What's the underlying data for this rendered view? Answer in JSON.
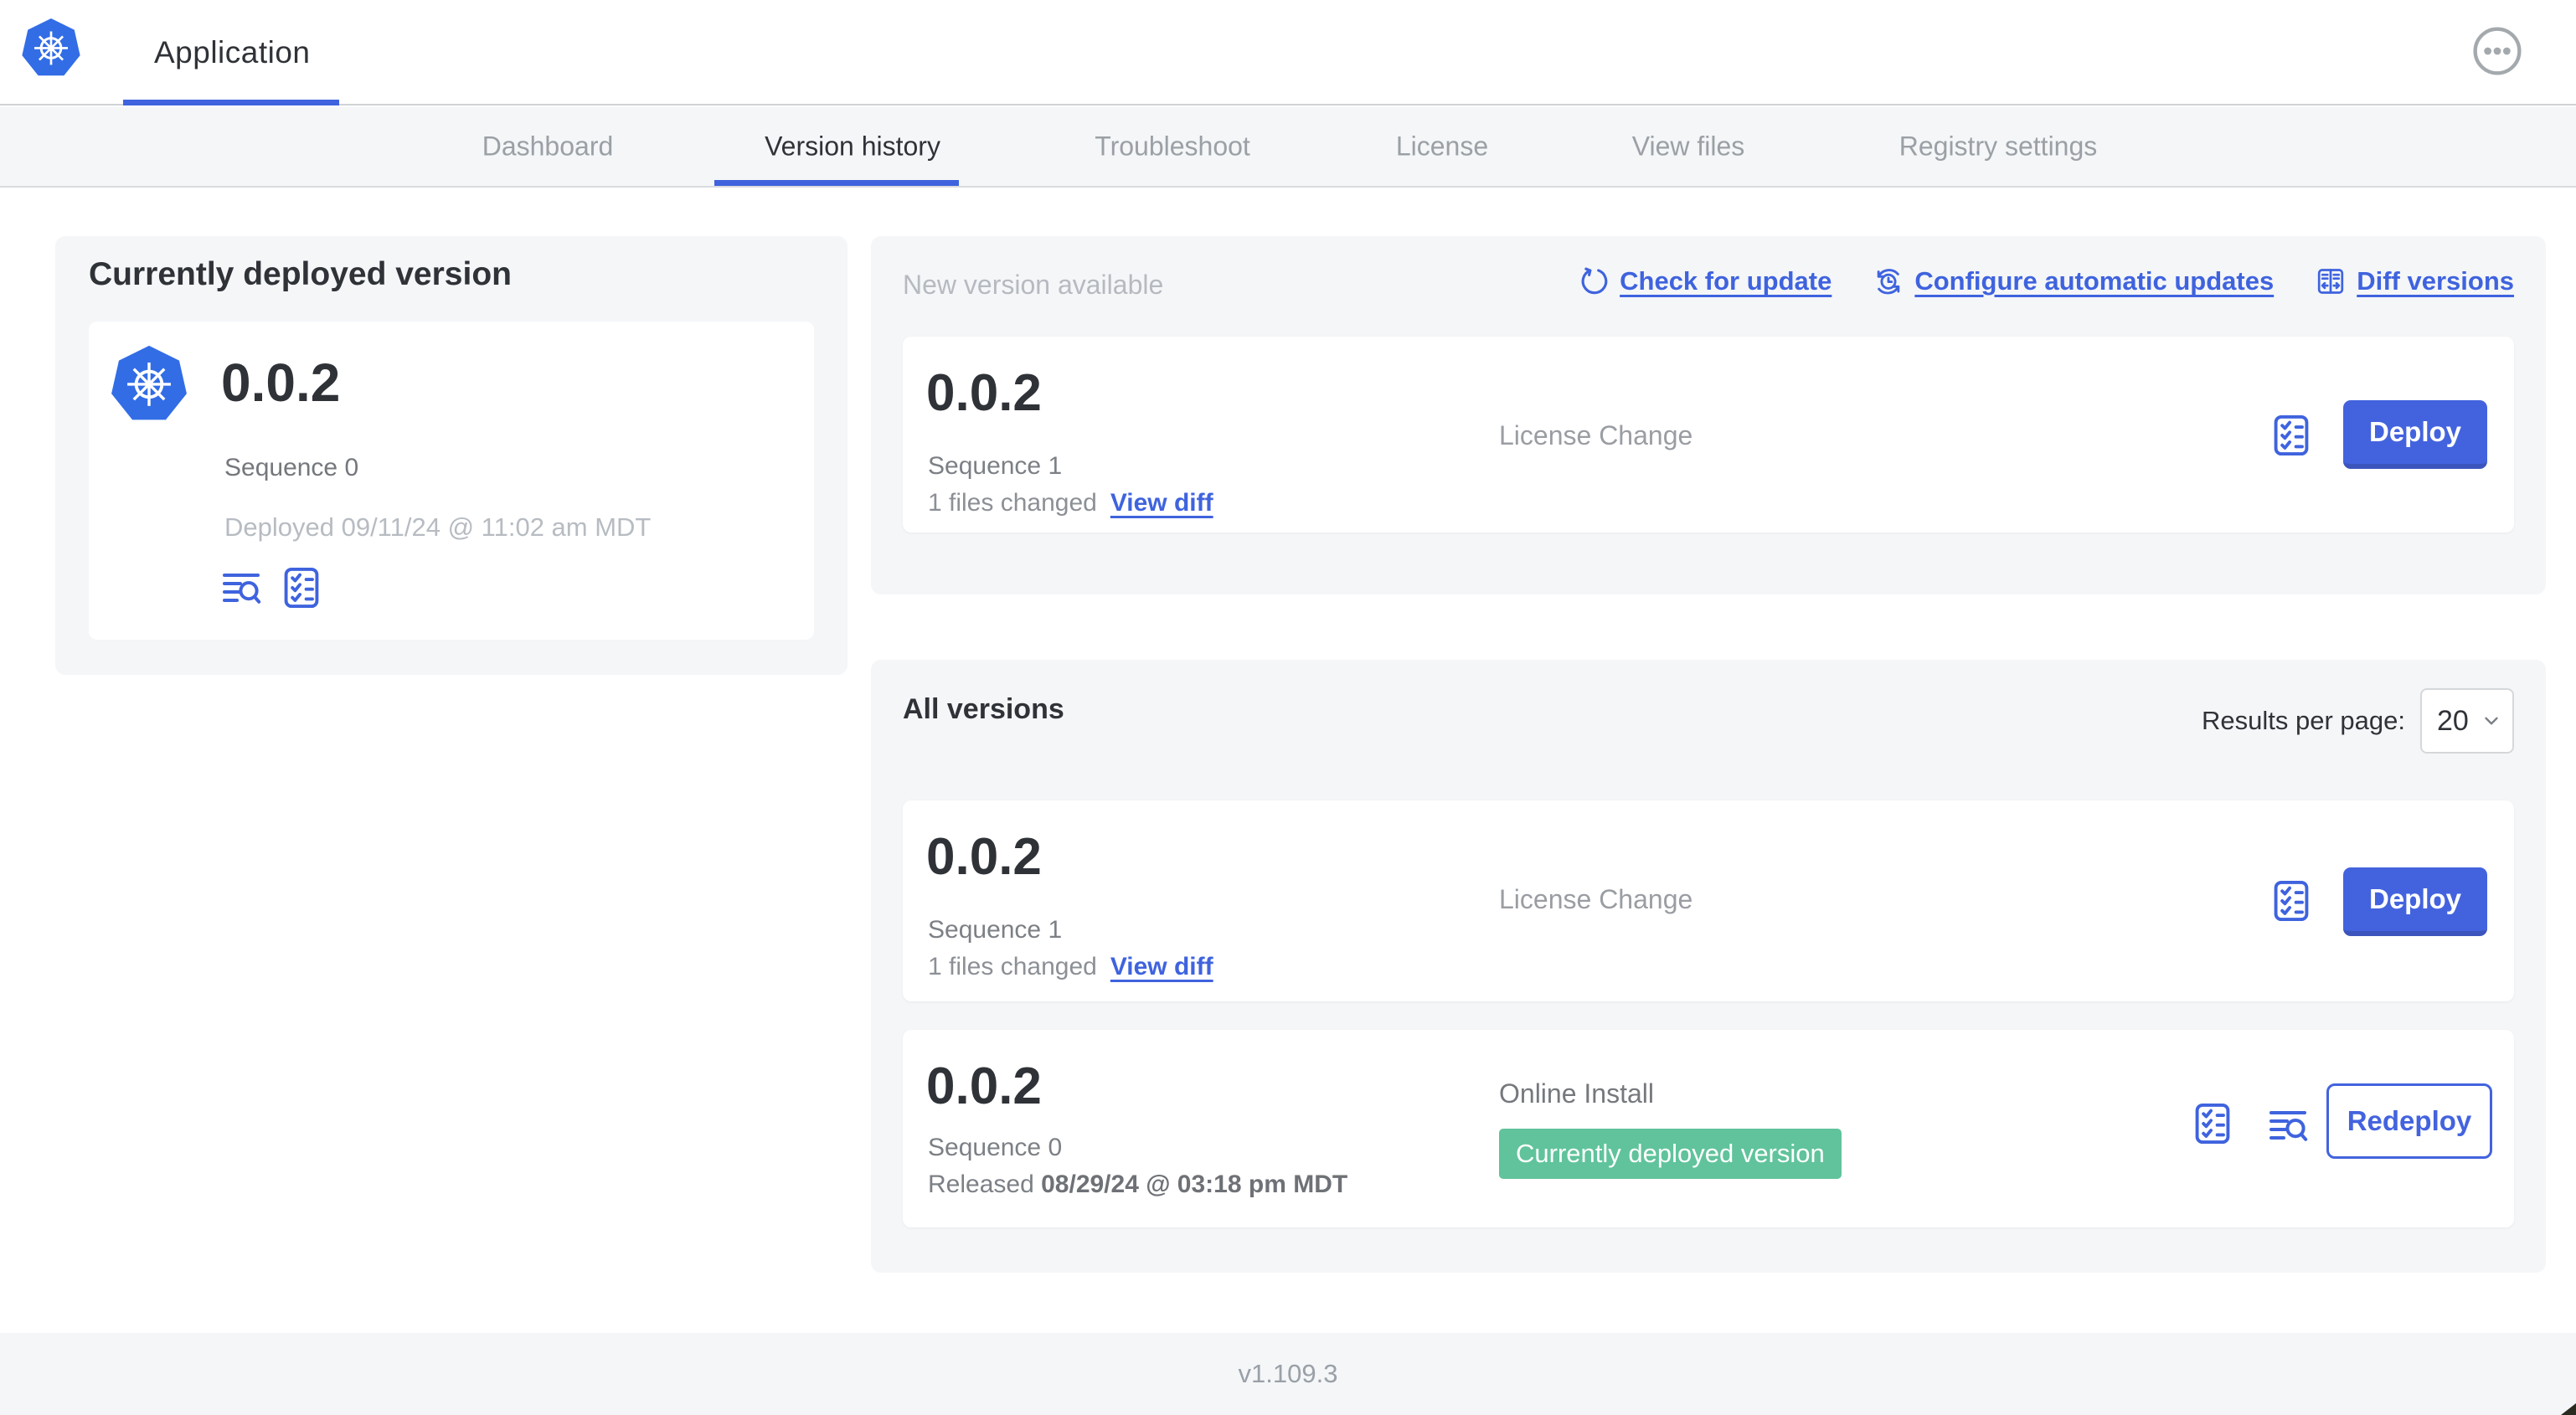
{
  "header": {
    "title": "Application"
  },
  "tabs": {
    "dashboard": "Dashboard",
    "version_history": "Version history",
    "troubleshoot": "Troubleshoot",
    "license": "License",
    "view_files": "View files",
    "registry_settings": "Registry settings"
  },
  "currently_deployed": {
    "heading": "Currently deployed version",
    "version": "0.0.2",
    "sequence": "Sequence 0",
    "deployed_at": "Deployed 09/11/24 @ 11:02 am MDT"
  },
  "new_version": {
    "heading": "New version available",
    "check_for_update": "Check for update",
    "configure_updates": "Configure automatic updates",
    "diff_versions": "Diff versions",
    "row": {
      "version": "0.0.2",
      "sequence": "Sequence 1",
      "files_changed": "1 files changed",
      "view_diff": "View diff",
      "source": "License Change",
      "action": "Deploy"
    }
  },
  "all_versions": {
    "heading": "All versions",
    "results_per_page_label": "Results per page:",
    "results_per_page_value": "20",
    "rows": [
      {
        "version": "0.0.2",
        "sequence": "Sequence 1",
        "files_changed": "1 files changed",
        "view_diff": "View diff",
        "source": "License Change",
        "action": "Deploy"
      },
      {
        "version": "0.0.2",
        "sequence": "Sequence 0",
        "released_label": "Released",
        "released_date": "08/29/24 @ 03:18 pm MDT",
        "source": "Online Install",
        "badge": "Currently deployed version",
        "action": "Redeploy"
      }
    ]
  },
  "footer": {
    "app_version": "v1.109.3"
  },
  "colors": {
    "accent_blue": "#3f63de",
    "badge_green": "#60c39b"
  }
}
